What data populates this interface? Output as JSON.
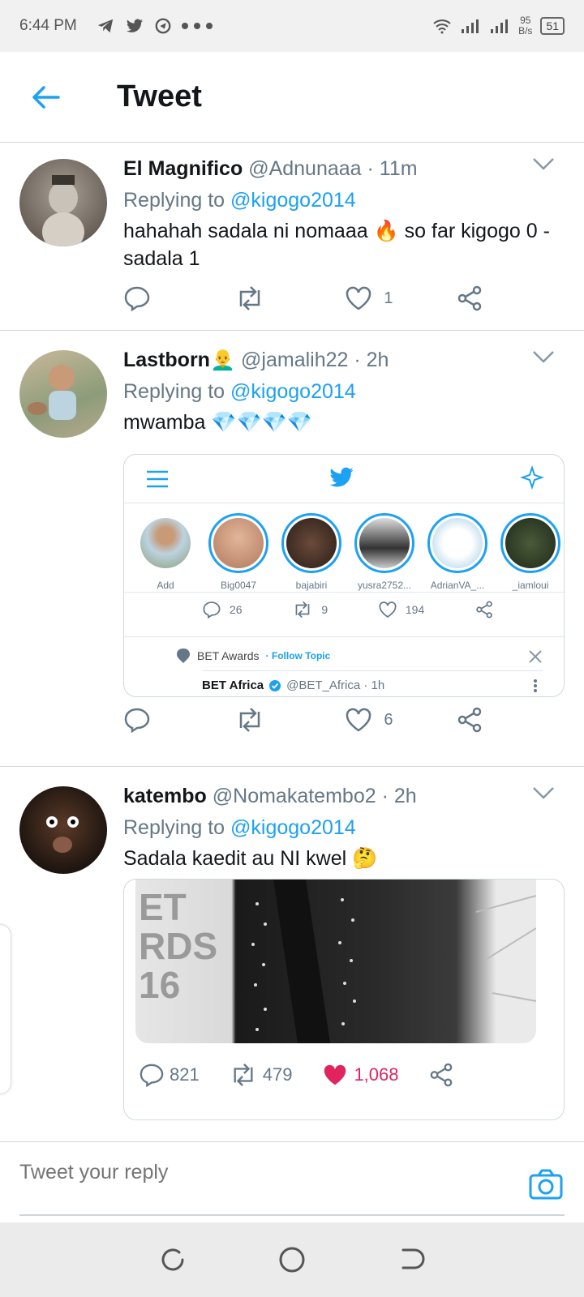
{
  "status": {
    "time": "6:44 PM",
    "speed_top": "95",
    "speed_unit": "B/s",
    "battery": "51"
  },
  "header": {
    "title": "Tweet"
  },
  "tweets": [
    {
      "name": "El Magnifico",
      "handle": "@Adnunaaa",
      "time": "· 11m",
      "replying_prefix": "Replying to ",
      "replying_to": "@kigogo2014",
      "text": "hahahah sadala ni nomaaa 🔥 so far kigogo 0 - sadala 1",
      "likes": "1"
    },
    {
      "name": "Lastborn👨‍🦲",
      "handle": "@jamalih22",
      "time": "· 2h",
      "replying_prefix": "Replying to ",
      "replying_to": "@kigogo2014",
      "text": "mwamba 💎💎💎💎",
      "likes": "6"
    },
    {
      "name": "katembo",
      "handle": "@Nomakatembo2",
      "time": "· 2h",
      "replying_prefix": "Replying to ",
      "replying_to": "@kigogo2014",
      "text": "Sadala kaedit au NI kwel 🤔"
    }
  ],
  "embedded_screenshot": {
    "stories": [
      {
        "label": "Add"
      },
      {
        "label": "Big0047"
      },
      {
        "label": "bajabiri"
      },
      {
        "label": "yusra2752..."
      },
      {
        "label": "AdrianVA_..."
      },
      {
        "label": "_iamloui"
      }
    ],
    "inner_counts": {
      "replies": "26",
      "retweets": "9",
      "likes": "194"
    },
    "topic": {
      "label": "BET Awards",
      "follow": "· Follow Topic"
    },
    "inner_tweet": {
      "name": "BET Africa",
      "handle": "@BET_Africa · 1h"
    }
  },
  "embedded_image": {
    "overlay_text": "ET\nRDS\n16",
    "counts": {
      "replies": "821",
      "retweets": "479",
      "likes": "1,068"
    }
  },
  "reply_bar": {
    "placeholder": "Tweet your reply"
  },
  "colors": {
    "accent": "#1da1f2",
    "like_pink": "#e0245e",
    "muted": "#657786"
  }
}
